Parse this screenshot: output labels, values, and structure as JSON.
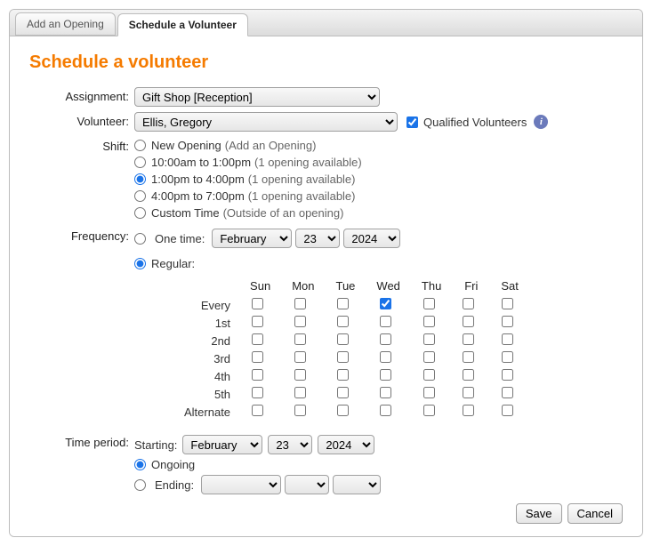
{
  "tabs": {
    "add_opening": "Add an Opening",
    "schedule_volunteer": "Schedule a Volunteer"
  },
  "title": "Schedule a volunteer",
  "labels": {
    "assignment": "Assignment:",
    "volunteer": "Volunteer:",
    "shift": "Shift:",
    "frequency": "Frequency:",
    "time_period": "Time period:"
  },
  "assignment": {
    "value": "Gift Shop [Reception]"
  },
  "volunteer": {
    "value": "Ellis, Gregory"
  },
  "qualified": {
    "checked": true,
    "label": "Qualified Volunteers"
  },
  "shift": {
    "selected": "1pm",
    "options": {
      "new": {
        "label": "New Opening",
        "note": "(Add an Opening)"
      },
      "10am": {
        "label": "10:00am to 1:00pm",
        "note": "(1 opening available)"
      },
      "1pm": {
        "label": "1:00pm to 4:00pm",
        "note": "(1 opening available)"
      },
      "4pm": {
        "label": "4:00pm to 7:00pm",
        "note": "(1 opening available)"
      },
      "custom": {
        "label": "Custom Time",
        "note": "(Outside of an opening)"
      }
    }
  },
  "frequency": {
    "selected": "regular",
    "one_time": {
      "label": "One time:",
      "month": "February",
      "day": "23",
      "year": "2024"
    },
    "regular": {
      "label": "Regular:"
    },
    "days": [
      "Sun",
      "Mon",
      "Tue",
      "Wed",
      "Thu",
      "Fri",
      "Sat"
    ],
    "rows": [
      "Every",
      "1st",
      "2nd",
      "3rd",
      "4th",
      "5th",
      "Alternate"
    ],
    "checked": {
      "row": "Every",
      "day": "Wed"
    }
  },
  "time_period": {
    "selected": "ongoing",
    "starting": {
      "label": "Starting:",
      "month": "February",
      "day": "23",
      "year": "2024"
    },
    "ongoing": {
      "label": "Ongoing"
    },
    "ending": {
      "label": "Ending:",
      "month": "",
      "day": "",
      "year": ""
    }
  },
  "buttons": {
    "save": "Save",
    "cancel": "Cancel"
  }
}
